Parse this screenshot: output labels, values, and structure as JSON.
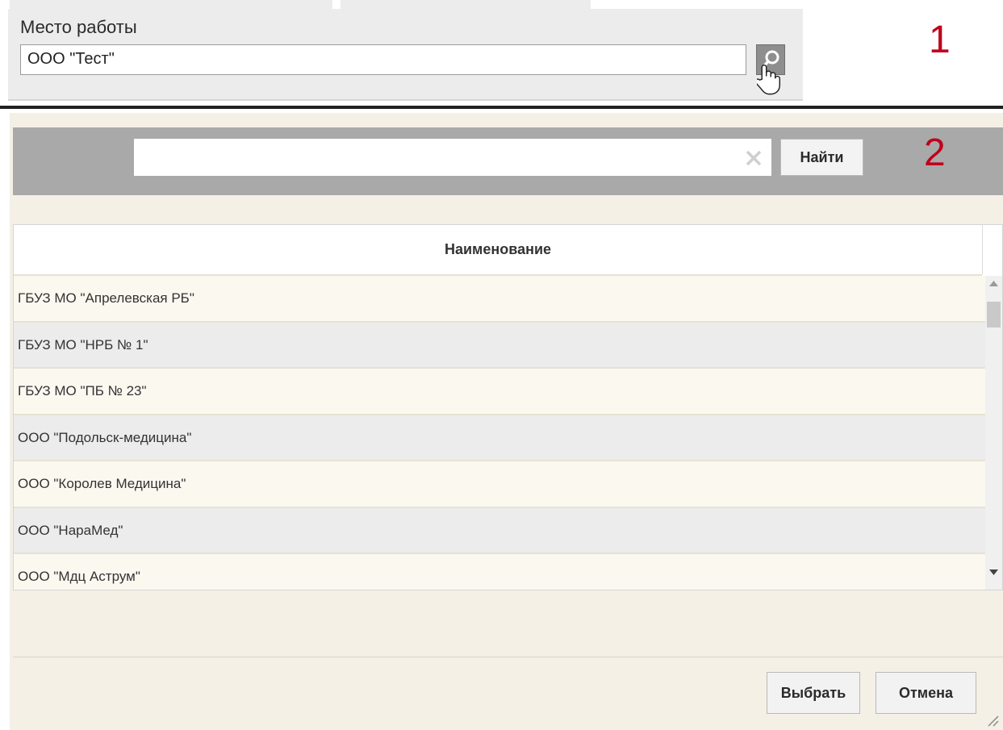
{
  "workplace": {
    "label": "Место работы",
    "value": "ООО \"Тест\"",
    "lookup_icon": "search-icon"
  },
  "markers": {
    "step1": "1",
    "step2": "2"
  },
  "dialog": {
    "search": {
      "value": "",
      "clear_icon": "close-icon",
      "find_label": "Найти"
    },
    "grid": {
      "columns": [
        "Наименование"
      ],
      "rows": [
        "ГБУЗ МО \"Апрелевская РБ\"",
        "ГБУЗ МО \"НРБ № 1\"",
        "ГБУЗ МО \"ПБ № 23\"",
        "ООО \"Подольск-медицина\"",
        "ООО \"Королев Медицина\"",
        "ООО \"НараМед\"",
        "ООО \"Мдц Аструм\""
      ]
    },
    "buttons": {
      "select": "Выбрать",
      "cancel": "Отмена"
    }
  },
  "colors": {
    "marker": "#c0001b",
    "search_bar": "#a9a9a9",
    "dialog_bg": "#f4f0e6"
  }
}
